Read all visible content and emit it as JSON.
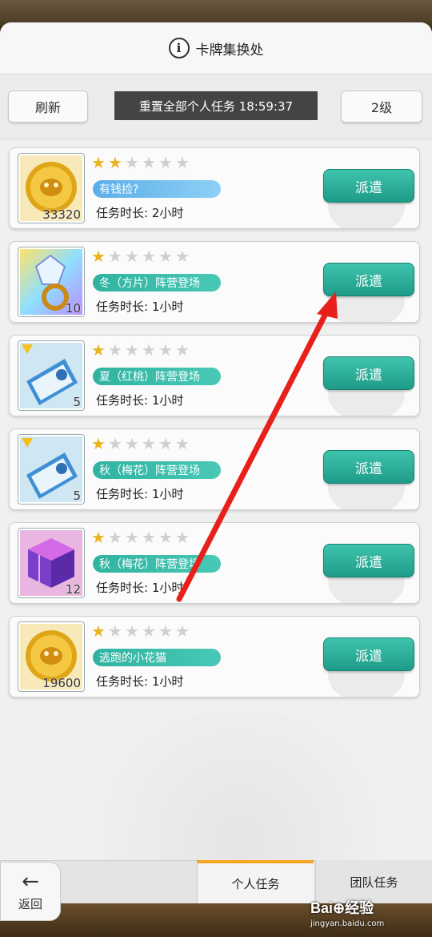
{
  "header": {
    "title": "卡牌集换处",
    "info_icon": "info-circle-icon"
  },
  "controls": {
    "refresh_label": "刷新",
    "reset_banner": "重置全部个人任务 18:59:37",
    "level_label": "2级"
  },
  "missions": [
    {
      "icon": "gold-coin-icon",
      "count": "33320",
      "stars": 2,
      "max_stars": 6,
      "tag": "有钱捡?",
      "tag_color": "blue",
      "duration": "任务时长:  2小时",
      "button": "派遣"
    },
    {
      "icon": "crystal-ring-icon",
      "count": "10",
      "stars": 1,
      "max_stars": 6,
      "tag": "冬（方片）阵营登场",
      "tag_color": "teal",
      "duration": "任务时长:  1小时",
      "button": "派遣"
    },
    {
      "icon": "ticket-icon",
      "count": "5",
      "stars": 1,
      "max_stars": 6,
      "tag": "夏（红桃）阵营登场",
      "tag_color": "teal",
      "duration": "任务时长:  1小时",
      "button": "派遣"
    },
    {
      "icon": "ticket-icon",
      "count": "5",
      "stars": 1,
      "max_stars": 6,
      "tag": "秋（梅花）阵营登场",
      "tag_color": "teal",
      "duration": "任务时长:  1小时",
      "button": "派遣"
    },
    {
      "icon": "purple-cube-icon",
      "count": "12",
      "stars": 1,
      "max_stars": 6,
      "tag": "秋（梅花）阵营登场",
      "tag_color": "teal",
      "duration": "任务时长:  1小时",
      "button": "派遣"
    },
    {
      "icon": "gold-coin-icon",
      "count": "19600",
      "stars": 1,
      "max_stars": 6,
      "tag": "逃跑的小花猫",
      "tag_color": "teal",
      "duration": "任务时长:  1小时",
      "button": "派遣"
    }
  ],
  "bottom": {
    "back_label": "返回",
    "tabs": [
      {
        "label": "个人任务",
        "active": true
      },
      {
        "label": "团队任务",
        "active": false
      }
    ]
  },
  "watermark": {
    "main": "Bai⊕经验",
    "sub": "jingyan.baidu.com"
  },
  "colors": {
    "accent": "#2fb3a0",
    "star": "#e8b521",
    "annotation": "#e8201c"
  }
}
